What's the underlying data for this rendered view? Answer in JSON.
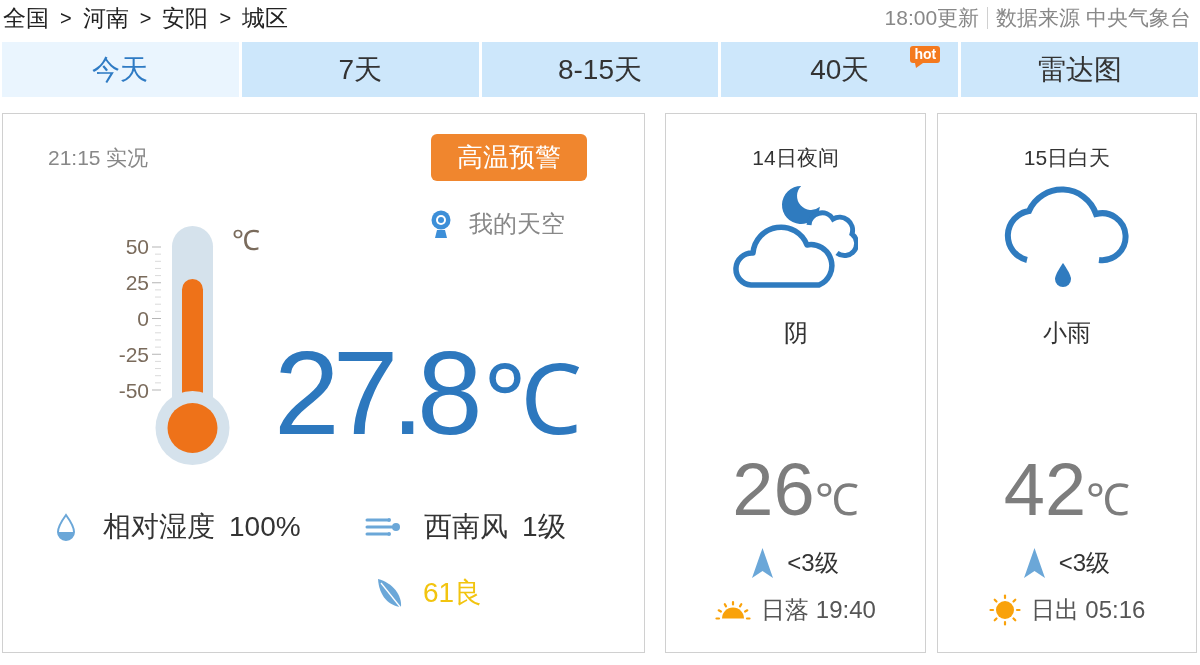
{
  "breadcrumb": [
    {
      "label": "全国",
      "separator": ">"
    },
    {
      "label": "河南",
      "separator": ">"
    },
    {
      "label": "安阳",
      "separator": ">"
    },
    {
      "label": "城区"
    }
  ],
  "update_time": "18:00更新",
  "source": "数据来源 中央气象台",
  "tabs": [
    {
      "label": "今天",
      "selected": true
    },
    {
      "label": "7天",
      "selected": false
    },
    {
      "label": "8-15天",
      "selected": false
    },
    {
      "label": "40天",
      "selected": false,
      "badge": "hot"
    },
    {
      "label": "雷达图",
      "selected": false
    }
  ],
  "current": {
    "observed": "21:15 实况",
    "alert": "高温预警",
    "my_sky": "我的天空",
    "thermometer": {
      "scale": [
        "50",
        "25",
        "0",
        "-25",
        "-50"
      ],
      "unit": "℃",
      "level": 0.74
    },
    "temperature": "27.8",
    "unit": "℃",
    "humidity": {
      "label": "相对湿度",
      "value": "100%"
    },
    "wind": {
      "direction": "西南风",
      "force": "1级"
    },
    "air_quality": {
      "label": "61良",
      "color": "#f2c40f"
    }
  },
  "forecast": [
    {
      "period": "14日夜间",
      "kind": "overcast",
      "condition": "阴",
      "temperature": "26",
      "unit": "℃",
      "wind": "<3级",
      "sun": {
        "kind": "sunset",
        "label": "日落 19:40"
      }
    },
    {
      "period": "15日白天",
      "kind": "rain",
      "condition": "小雨",
      "temperature": "42",
      "unit": "℃",
      "wind": "<3级",
      "sun": {
        "kind": "sunrise",
        "label": "日出 05:16"
      }
    }
  ]
}
